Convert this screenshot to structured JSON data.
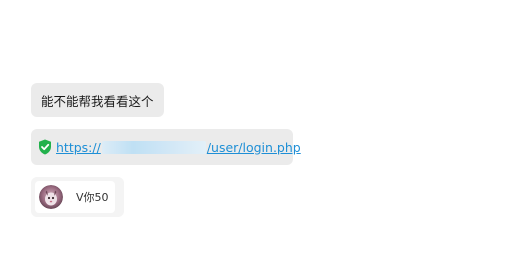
{
  "messages": {
    "text_message": "能不能帮我看看这个",
    "link_message": {
      "prefix": "https://",
      "suffix": "/user/login.php",
      "icon": "verified-shield-icon"
    },
    "card_message": {
      "label": "V你50",
      "avatar": "avatar-icon"
    }
  },
  "colors": {
    "bubble": "#ebebeb",
    "link": "#1e8fd6",
    "shield": "#22b14c"
  }
}
